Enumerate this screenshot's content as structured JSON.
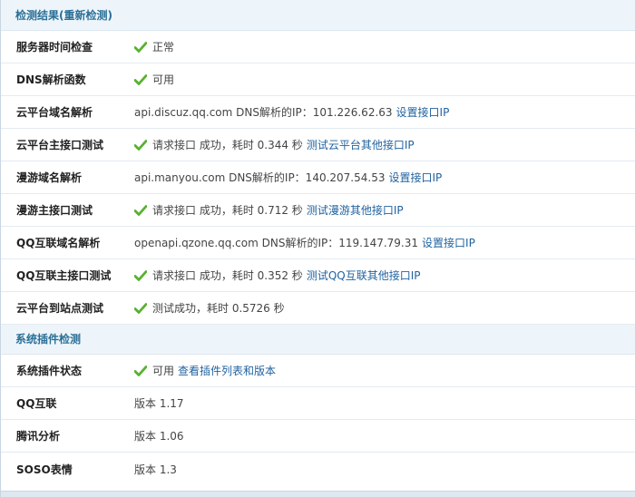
{
  "section1": {
    "title": "检测结果(重新检测)",
    "rows": [
      {
        "label": "服务器时间检查",
        "text": "正常"
      },
      {
        "label": "DNS解析函数",
        "text": "可用"
      },
      {
        "label": "云平台域名解析",
        "text": "api.discuz.qq.com DNS解析的IP：101.226.62.63",
        "link": "设置接口IP"
      },
      {
        "label": "云平台主接口测试",
        "text": "请求接口 成功，耗时 0.344 秒",
        "link": "测试云平台其他接口IP"
      },
      {
        "label": "漫游域名解析",
        "text": "api.manyou.com DNS解析的IP：140.207.54.53",
        "link": "设置接口IP"
      },
      {
        "label": "漫游主接口测试",
        "text": "请求接口 成功，耗时 0.712 秒",
        "link": "测试漫游其他接口IP"
      },
      {
        "label": "QQ互联域名解析",
        "text": "openapi.qzone.qq.com DNS解析的IP：119.147.79.31",
        "link": "设置接口IP"
      },
      {
        "label": "QQ互联主接口测试",
        "text": "请求接口 成功，耗时 0.352 秒",
        "link": "测试QQ互联其他接口IP"
      },
      {
        "label": "云平台到站点测试",
        "text": "测试成功，耗时 0.5726 秒"
      }
    ]
  },
  "section2": {
    "title": "系统插件检测",
    "rows": [
      {
        "label": "系统插件状态",
        "text": "可用",
        "link": "查看插件列表和版本"
      },
      {
        "label": "QQ互联",
        "text": "版本 1.17"
      },
      {
        "label": "腾讯分析",
        "text": "版本 1.06"
      },
      {
        "label": "SOSO表情",
        "text": "版本 1.3"
      }
    ]
  },
  "icons": {
    "check": "check-icon",
    "check_color": "#58b12f"
  }
}
